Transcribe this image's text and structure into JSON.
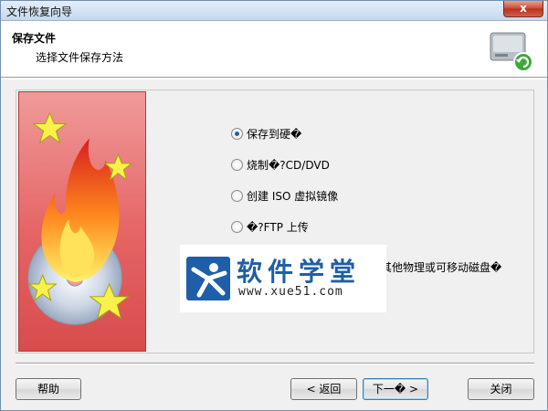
{
  "window": {
    "title": "文件恢复向导",
    "close_glyph": "x"
  },
  "header": {
    "title": "保存文件",
    "subtitle": "选择文件保存方法",
    "icon": "hard-drive-restore-icon"
  },
  "options": [
    {
      "label": "保存到硬�",
      "checked": true
    },
    {
      "label": "烧制�?CD/DVD",
      "checked": false
    },
    {
      "label": "创建 ISO 虚拟镜像",
      "checked": false
    },
    {
      "label": "�?FTP 上传",
      "checked": false
    },
    {
      "label": "其他物理或可移动磁盘�",
      "checked": false
    }
  ],
  "watermark": {
    "title": "软件学堂",
    "url": "www.xue51.com"
  },
  "buttons": {
    "help": "帮助",
    "back": "< 返回",
    "next": "下一� >",
    "close": "关闭"
  },
  "colors": {
    "accent": "#1f5ea8",
    "side_panel": "#e56464"
  }
}
